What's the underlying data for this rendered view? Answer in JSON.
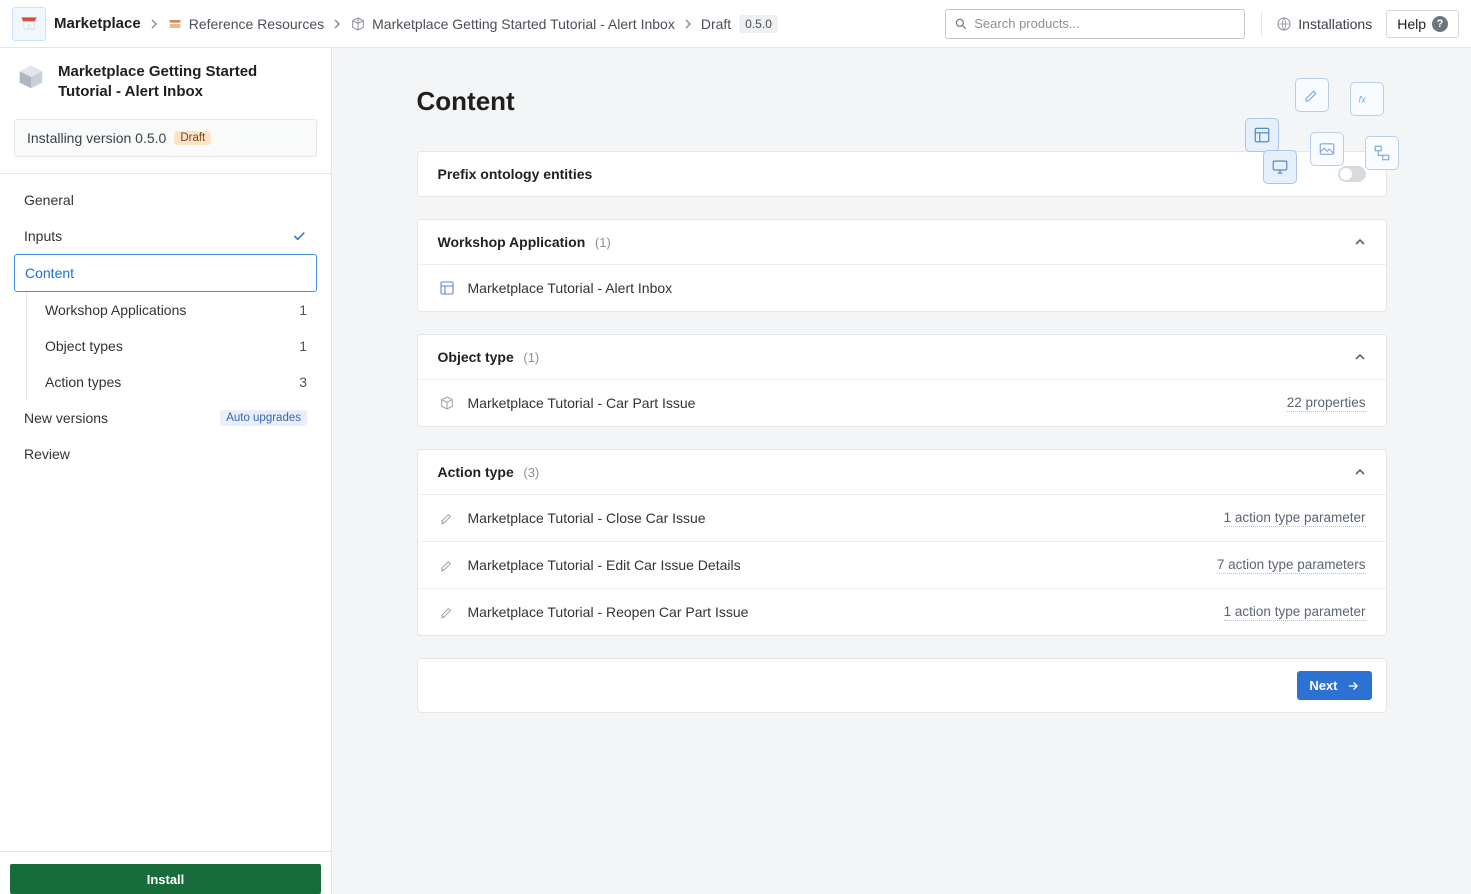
{
  "topbar": {
    "brand": "Marketplace",
    "crumbs": [
      {
        "label": "Reference Resources"
      },
      {
        "label": "Marketplace Getting Started Tutorial - Alert Inbox"
      },
      {
        "label": "Draft"
      }
    ],
    "version_pill": "0.5.0",
    "search_placeholder": "Search products...",
    "installations_label": "Installations",
    "help_label": "Help"
  },
  "sidebar": {
    "title": "Marketplace Getting Started Tutorial - Alert Inbox",
    "installing_text": "Installing version 0.5.0",
    "draft_pill": "Draft",
    "nav": {
      "general": "General",
      "inputs": "Inputs",
      "content": "Content",
      "sub": [
        {
          "label": "Workshop Applications",
          "count": "1"
        },
        {
          "label": "Object types",
          "count": "1"
        },
        {
          "label": "Action types",
          "count": "3"
        }
      ],
      "new_versions": "New versions",
      "auto_badge": "Auto upgrades",
      "review": "Review"
    },
    "install_btn": "Install"
  },
  "main": {
    "title": "Content",
    "prefix_label": "Prefix ontology entities",
    "sections": {
      "workshop": {
        "title": "Workshop Application",
        "count": "(1)",
        "items": [
          {
            "label": "Marketplace Tutorial - Alert Inbox"
          }
        ]
      },
      "object": {
        "title": "Object type",
        "count": "(1)",
        "items": [
          {
            "label": "Marketplace Tutorial - Car Part Issue",
            "meta": "22 properties"
          }
        ]
      },
      "action": {
        "title": "Action type",
        "count": "(3)",
        "items": [
          {
            "label": "Marketplace Tutorial - Close Car Issue",
            "meta": "1 action type parameter"
          },
          {
            "label": "Marketplace Tutorial - Edit Car Issue Details",
            "meta": "7 action type parameters"
          },
          {
            "label": "Marketplace Tutorial - Reopen Car Part Issue",
            "meta": "1 action type parameter"
          }
        ]
      }
    },
    "next_btn": "Next"
  }
}
